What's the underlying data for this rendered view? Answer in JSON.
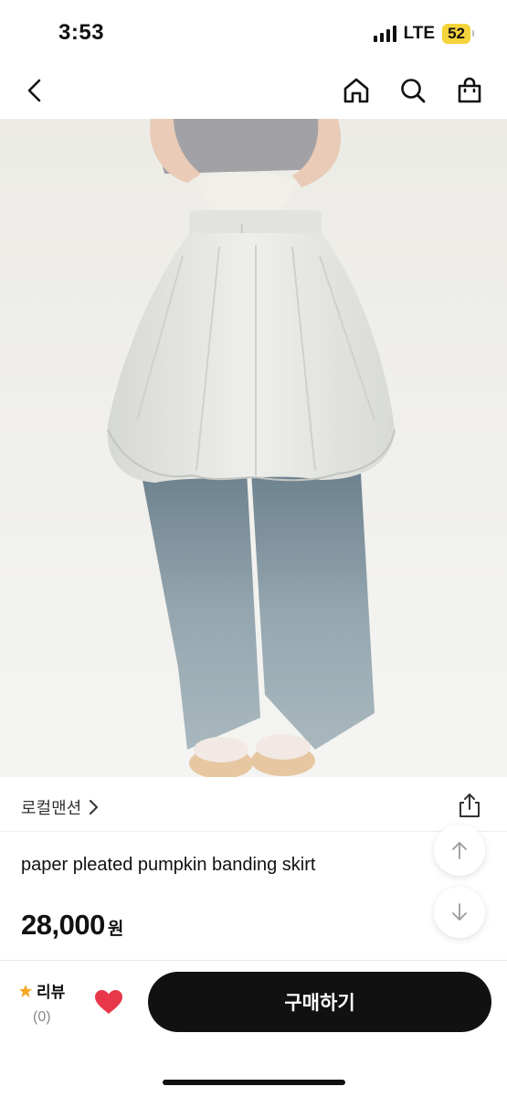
{
  "status_bar": {
    "time": "3:53",
    "network": "LTE",
    "battery": "52"
  },
  "nav": {
    "back_icon": "chevron-left-icon",
    "home_icon": "home-icon",
    "search_icon": "search-icon",
    "cart_icon": "shopping-bag-icon"
  },
  "product": {
    "image_alt": "product-photo",
    "brand": "로컬맨션",
    "title": "paper pleated pumpkin banding skirt",
    "price": "28,000",
    "currency_unit": "원"
  },
  "floating": {
    "up_icon": "arrow-up-icon",
    "down_icon": "arrow-down-icon"
  },
  "bottom_bar": {
    "review_label": "리뷰",
    "review_count": "(0)",
    "buy_label": "구매하기",
    "wish_icon": "heart-icon",
    "colors": {
      "heart": "#e8374a",
      "buy_bg": "#111111",
      "star": "#f5a623"
    }
  }
}
